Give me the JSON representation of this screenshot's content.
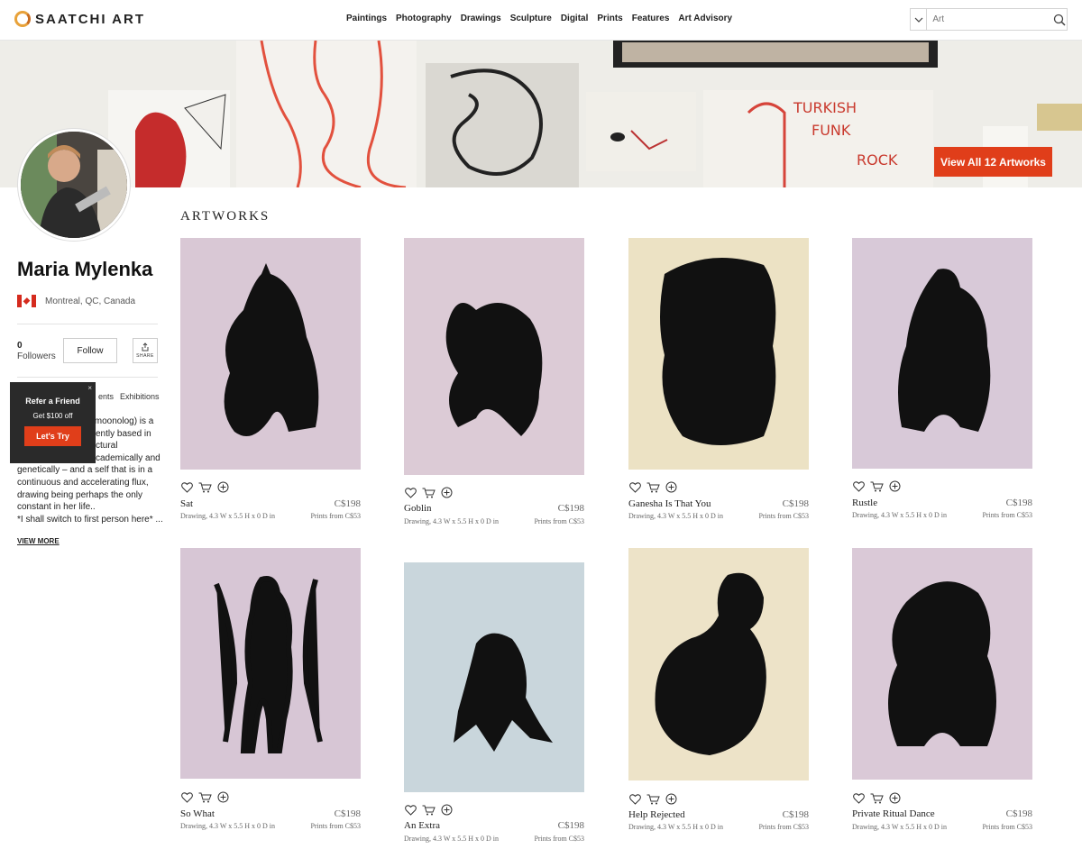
{
  "header": {
    "logo_text": "SAATCHI ART",
    "nav": [
      "Paintings",
      "Photography",
      "Drawings",
      "Sculpture",
      "Digital",
      "Prints",
      "Features",
      "Art Advisory"
    ],
    "search_placeholder": "Art"
  },
  "banner": {
    "view_all_label": "View All 12 Artworks"
  },
  "profile": {
    "name": "Maria Mylenka",
    "location": "Montreal, QC, Canada",
    "followers_count": "0",
    "followers_label": "Followers",
    "follow_label": "Follow",
    "share_label": "SHARE",
    "tabs": {
      "events": "ents",
      "exhibitions": "Exhibitions"
    },
    "bio": [
      "s moonolog) is a",
      "ently based in",
      "ctural",
      "cademically and",
      "genetically – and a self that is in a",
      "continuous and accelerating flux,",
      "drawing being perhaps the only",
      "constant in her life..",
      "*I shall switch to first person here* ..."
    ],
    "view_more_label": "VIEW MORE"
  },
  "refer": {
    "close": "×",
    "title": "Refer a Friend",
    "subtitle": "Get $100 off",
    "button": "Let's Try"
  },
  "artworks_title": "ARTWORKS",
  "artworks": [
    {
      "title": "Sat",
      "price": "C$198",
      "meta": "Drawing, 4.3 W x 5.5 H x 0 D in",
      "prints": "Prints from C$53",
      "bg": "#d9c8d5"
    },
    {
      "title": "Goblin",
      "price": "C$198",
      "meta": "Drawing, 4.3 W x 5.5 H x 0 D in",
      "prints": "Prints from C$53",
      "bg": "#dccbd6"
    },
    {
      "title": "Ganesha Is That You",
      "price": "C$198",
      "meta": "Drawing, 4.3 W x 5.5 H x 0 D in",
      "prints": "Prints from C$53",
      "bg": "#ece2c4"
    },
    {
      "title": "Rustle",
      "price": "C$198",
      "meta": "Drawing, 4.3 W x 5.5 H x 0 D in",
      "prints": "Prints from C$53",
      "bg": "#d8c9d8"
    },
    {
      "title": "So What",
      "price": "C$198",
      "meta": "Drawing, 4.3 W x 5.5 H x 0 D in",
      "prints": "Prints from C$53",
      "bg": "#d7c6d5"
    },
    {
      "title": "An Extra",
      "price": "C$198",
      "meta": "Drawing, 4.3 W x 5.5 H x 0 D in",
      "prints": "Prints from C$53",
      "bg": "#c9d6dc"
    },
    {
      "title": "Help Rejected",
      "price": "C$198",
      "meta": "Drawing, 4.3 W x 5.5 H x 0 D in",
      "prints": "Prints from C$53",
      "bg": "#ede3c8"
    },
    {
      "title": "Private Ritual Dance",
      "price": "C$198",
      "meta": "Drawing, 4.3 W x 5.5 H x 0 D in",
      "prints": "Prints from C$53",
      "bg": "#dac9d7"
    }
  ],
  "colors": {
    "accent": "#e03e1a",
    "refer_bg": "#2a2a2a"
  }
}
